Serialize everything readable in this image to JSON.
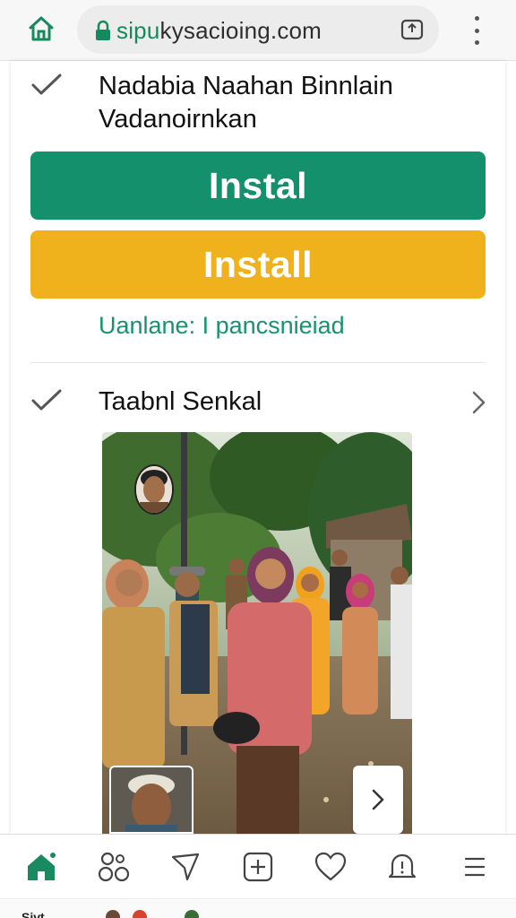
{
  "browser": {
    "url_secure_part": "sipu",
    "url_rest": "kysacioing.com",
    "home_icon": "home-icon",
    "lock_icon": "lock-icon",
    "tabs_icon": "tabs-icon",
    "menu_icon": "kebab-menu-icon"
  },
  "section1": {
    "title_line1": "Nadabia Naahan Binnlain",
    "title_line2": "Vadanoirnkan",
    "install_green_label": "Instal",
    "install_yellow_label": "Install",
    "sub_link": "Uanlane: I pancsnieiad"
  },
  "section2": {
    "title": "Taabnl Senkal"
  },
  "colors": {
    "green": "#14906c",
    "yellow": "#efb21d",
    "link": "#179271"
  },
  "bottom_nav": [
    {
      "icon": "home-icon"
    },
    {
      "icon": "people-icon"
    },
    {
      "icon": "send-icon"
    },
    {
      "icon": "add-icon"
    },
    {
      "icon": "heart-icon"
    },
    {
      "icon": "bell-icon"
    },
    {
      "icon": "menu-icon"
    }
  ],
  "bottom_strip": {
    "text": "Sivt"
  }
}
